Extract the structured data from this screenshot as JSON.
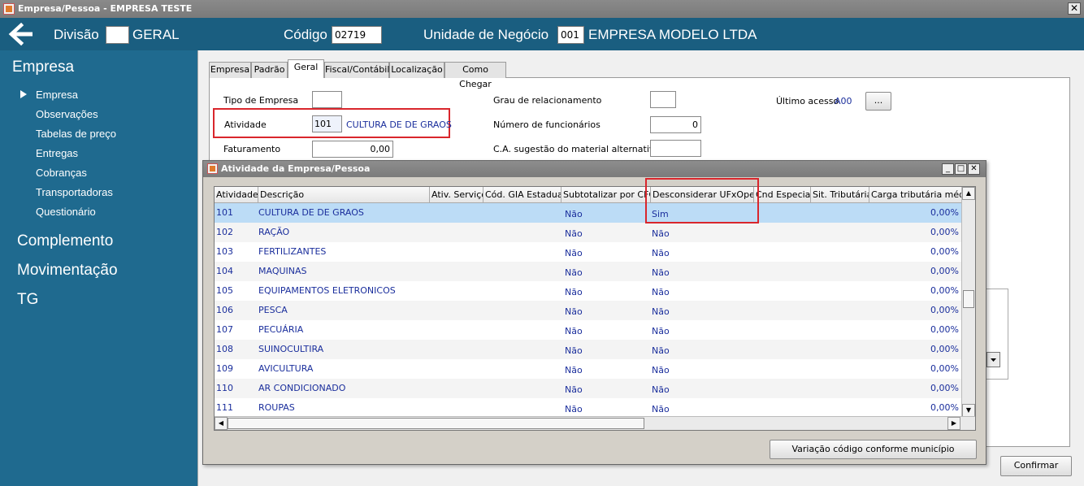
{
  "window": {
    "title": "Empresa/Pessoa - EMPRESA TESTE",
    "close_glyph": "✕"
  },
  "header": {
    "divisao_label": "Divisão",
    "divisao_value": "",
    "divisao_name": "GERAL",
    "codigo_label": "Código",
    "codigo_value": "02719",
    "unidade_label": "Unidade de Negócio",
    "unidade_code": "001",
    "unidade_name": "EMPRESA MODELO LTDA"
  },
  "sidebar": {
    "section": "Empresa",
    "items": [
      "Empresa",
      "Observações",
      "Tabelas de preço",
      "Entregas",
      "Cobranças",
      "Transportadoras",
      "Questionário"
    ],
    "groups": [
      "Complemento",
      "Movimentação",
      "TG"
    ]
  },
  "tabs": [
    "Empresa",
    "Padrão",
    "Geral",
    "Fiscal/Contábil",
    "Localização",
    "Como Chegar"
  ],
  "form": {
    "tipo_empresa_label": "Tipo de Empresa",
    "tipo_empresa_value": "",
    "atividade_label": "Atividade",
    "atividade_code": "101",
    "atividade_name": "CULTURA DE DE GRAOS",
    "faturamento_label": "Faturamento",
    "faturamento_value": "0,00",
    "grau_label": "Grau de relacionamento",
    "grau_value": "",
    "num_func_label": "Número de funcionários",
    "num_func_value": "0",
    "ca_label": "C.A. sugestão do material alternativo",
    "ca_value": "",
    "ultimo_acesso_label": "Último acesso",
    "ultimo_acesso_value": "A00",
    "ellipsis_button": "...",
    "confirm_button": "Confirmar"
  },
  "dialog": {
    "title": "Atividade da Empresa/Pessoa",
    "minimize": "_",
    "maximize": "□",
    "close": "✕",
    "columns": [
      "Atividade",
      "Descrição",
      "Ativ. Serviço",
      "Cód. GIA Estadual",
      "Subtotalizar por CFOP",
      "Desconsiderar UFxOper.",
      "Cnd Especial",
      "Sit. Tributária",
      "Carga tributária média"
    ],
    "rows": [
      [
        "101",
        "CULTURA DE DE GRAOS",
        "Não",
        "Sim",
        "0,00%"
      ],
      [
        "102",
        "RAÇÃO",
        "Não",
        "Não",
        "0,00%"
      ],
      [
        "103",
        "FERTILIZANTES",
        "Não",
        "Não",
        "0,00%"
      ],
      [
        "104",
        "MAQUINAS",
        "Não",
        "Não",
        "0,00%"
      ],
      [
        "105",
        "EQUIPAMENTOS ELETRONICOS",
        "Não",
        "Não",
        "0,00%"
      ],
      [
        "106",
        "PESCA",
        "Não",
        "Não",
        "0,00%"
      ],
      [
        "107",
        "PECUÁRIA",
        "Não",
        "Não",
        "0,00%"
      ],
      [
        "108",
        "SUINOCULTIRA",
        "Não",
        "Não",
        "0,00%"
      ],
      [
        "109",
        "AVICULTURA",
        "Não",
        "Não",
        "0,00%"
      ],
      [
        "110",
        "AR CONDICIONADO",
        "Não",
        "Não",
        "0,00%"
      ],
      [
        "111",
        "ROUPAS",
        "Não",
        "Não",
        "0,00%"
      ]
    ],
    "variation_button": "Variação código conforme município"
  },
  "colors": {
    "header": "#1a5e80",
    "sidebar": "#1f6a8f",
    "highlight": "#d9262c",
    "selected_row": "#bcdcf6",
    "text_blue": "#1a2e9c"
  }
}
